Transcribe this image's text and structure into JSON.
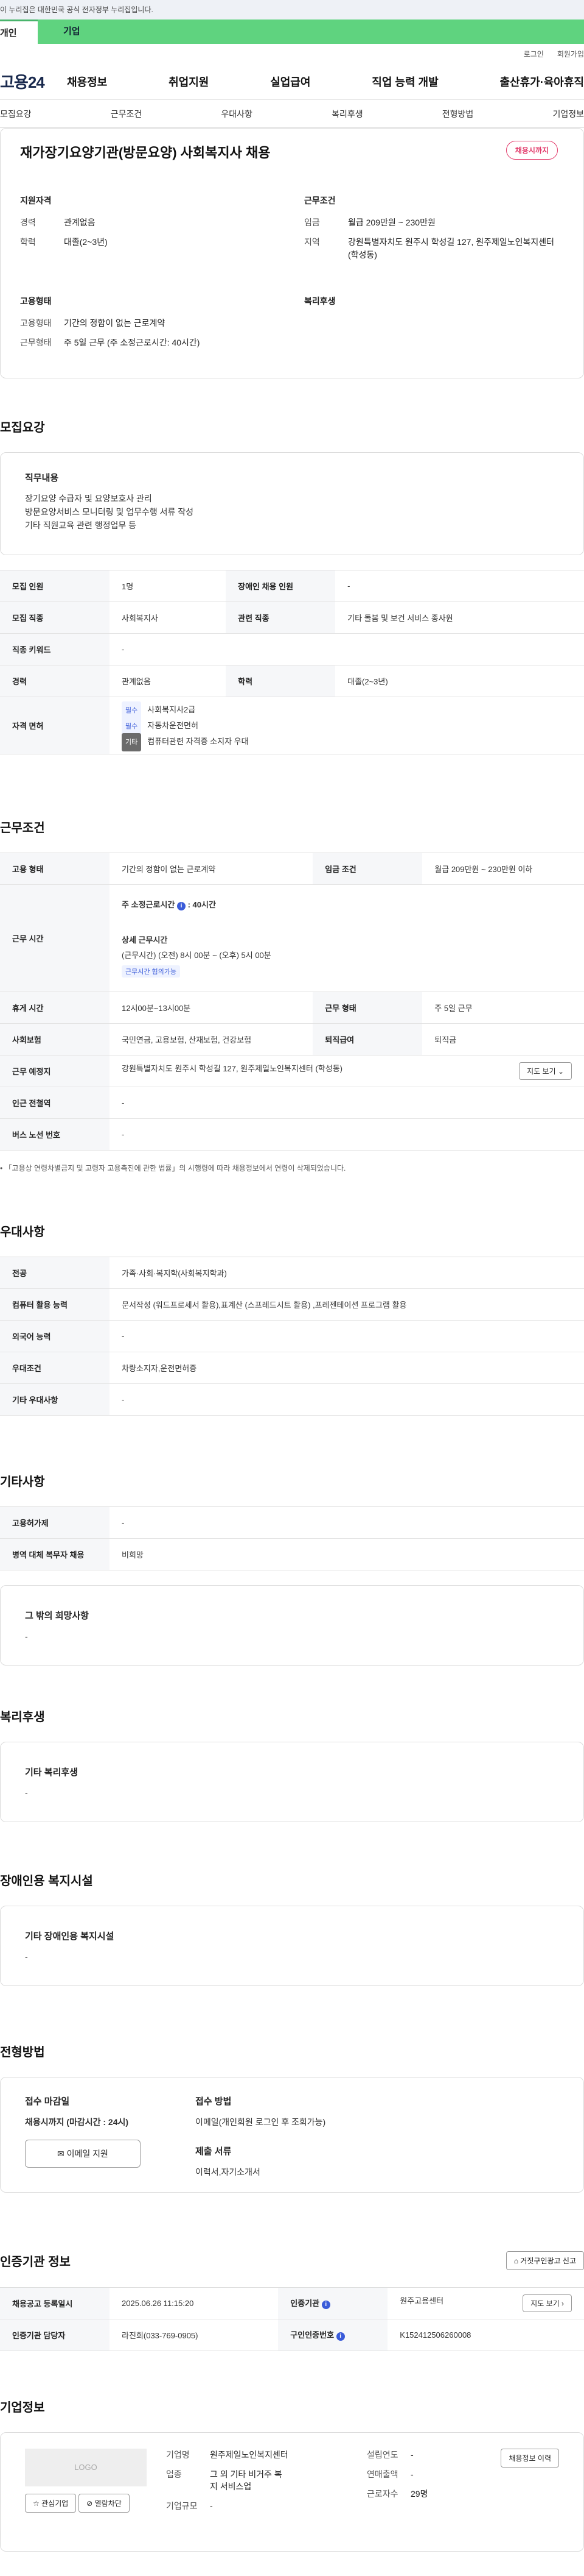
{
  "gov_banner": "이 누리집은 대한민국 공식 전자정부 누리집입니다.",
  "user_tabs": {
    "personal": "개인",
    "company": "기업"
  },
  "util": {
    "login": "로그인",
    "signup": "회원가입"
  },
  "logo": "고용24",
  "gnb": [
    "채용정보",
    "취업지원",
    "실업급여",
    "직업 능력 개발",
    "출산휴가·육아휴직"
  ],
  "lnb": [
    "모집요강",
    "근무조건",
    "우대사항",
    "복리후생",
    "전형방법",
    "기업정보"
  ],
  "job": {
    "title": "재가장기요양기관(방문요양) 사회복지사 채용",
    "deadline_badge": "채용시까지",
    "summary": {
      "qualification_title": "지원자격",
      "career_label": "경력",
      "career_value": "관계없음",
      "education_label": "학력",
      "education_value": "대졸(2~3년)",
      "conditions_title": "근무조건",
      "wage_label": "임금",
      "wage_value": "월급 209만원 ~ 230만원",
      "region_label": "지역",
      "region_value": "강원특별자치도 원주시 학성길 127, 원주제일노인복지센터 (학성동)",
      "employment_title": "고용형태",
      "employment_label": "고용형태",
      "employment_value": "기간의 정함이 없는 근로계약",
      "worktime_label": "근무형태",
      "worktime_value": "주 5일 근무 (주 소정근로시간: 40시간)",
      "welfare_title": "복리후생"
    }
  },
  "recruit": {
    "section_title": "모집요강",
    "duty_title": "직무내용",
    "duty_lines": [
      "장기요양 수급자 및 요양보호사 관리",
      "방문요양서비스 모니터링 및 업무수행 서류 작성",
      "기타 직원교육 관련 행정업무 등"
    ],
    "rows": {
      "count_k": "모집 인원",
      "count_v": "1명",
      "disabled_k": "장애인 채용 인원",
      "disabled_v": "-",
      "job_k": "모집 직종",
      "job_v": "사회복지사",
      "related_k": "관련 직종",
      "related_v": "기타 돌봄 및 보건 서비스 종사원",
      "keyword_k": "직종 키워드",
      "keyword_v": "-",
      "career_k": "경력",
      "career_v": "관계없음",
      "edu_k": "학력",
      "edu_v": "대졸(2~3년)",
      "license_k": "자격 면허"
    },
    "licenses": [
      {
        "tag": "필수",
        "name": "사회복지사2급"
      },
      {
        "tag": "필수",
        "name": "자동차운전면허"
      },
      {
        "tag": "기타",
        "name": "컴퓨터관련 자격증 소지자 우대"
      }
    ]
  },
  "conditions": {
    "section_title": "근무조건",
    "emp_k": "고용 형태",
    "emp_v": "기간의 정함이 없는 근로계약",
    "wage_k": "임금 조건",
    "wage_v": "월급 209만원 ~ 230만원 이하",
    "time_k": "근무 시간",
    "time_main": "주 소정근로시간",
    "time_hours": "40시간",
    "time_detail_title": "상세 근무시간",
    "time_detail": "(근무시간) (오전) 8시 00분 ~ (오후) 5시 00분",
    "time_consult": "근무시간 협의가능",
    "break_k": "휴게 시간",
    "break_v": "12시00분~13시00분",
    "type_k": "근무 형태",
    "type_v": "주 5일 근무",
    "ins_k": "사회보험",
    "ins_v": "국민연금, 고용보험, 산재보험, 건강보험",
    "sev_k": "퇴직급여",
    "sev_v": "퇴직금",
    "addr_k": "근무 예정지",
    "addr_v": "강원특별자치도 원주시 학성길 127, 원주제일노인복지센터 (학성동)",
    "map_btn": "지도 보기",
    "station_k": "인근 전철역",
    "station_v": "-",
    "bus_k": "버스 노선 번호",
    "bus_v": "-",
    "note": "「고용상 연령차별금지 및 고령자 고용촉진에 관한 법률」의 시행령에 따라 채용정보에서 연령이 삭제되었습니다."
  },
  "preferences": {
    "section_title": "우대사항",
    "major_k": "전공",
    "major_v": "가족·사회·복지학(사회복지학과)",
    "computer_k": "컴퓨터 활용 능력",
    "computer_v": "문서작성 (워드프로세서 활용),표계산 (스프레드시트 활용) ,프레젠테이션 프로그램 활용",
    "lang_k": "외국어 능력",
    "lang_v": "-",
    "cond_k": "우대조건",
    "cond_v": "차량소지자,운전면허증",
    "etc_k": "기타 우대사항",
    "etc_v": "-"
  },
  "others": {
    "section_title": "기타사항",
    "device_k": "고용허가제",
    "device_v": "-",
    "military_k": "병역 대체 복무자 채용",
    "military_v": "비희망",
    "wish_title": "그 밖의 희망사항",
    "wish_v": "-"
  },
  "welfare": {
    "section_title": "복리후생",
    "box_title": "기타 복리후생",
    "box_v": "-"
  },
  "disabled": {
    "section_title": "장애인용 복지시설",
    "box_title": "기타 장애인용 복지시설",
    "box_v": "-"
  },
  "selection": {
    "section_title": "전형방법",
    "deadline_title": "접수 마감일",
    "deadline_v": "채용시까지 (마감시간 : 24시)",
    "method_title": "접수 방법",
    "method_v": "이메일(개인회원 로그인 후 조회가능)",
    "docs_title": "제출 서류",
    "docs_v": "이력서,자기소개서",
    "email_btn": "이메일 지원"
  },
  "certification": {
    "section_title": "인증기관 정보",
    "report_btn": "거짓구인광고 신고",
    "reg_k": "채용공고 등록일시",
    "reg_v": "2025.06.26 11:15:20",
    "org_k": "인증기관",
    "org_v": "원주고용센터",
    "map_btn": "지도 보기",
    "manager_k": "인증기관 담당자",
    "manager_v": "라진희(033-769-0905)",
    "id_k": "구인인증번호",
    "id_v": "K152412506260008"
  },
  "company": {
    "section_title": "기업정보",
    "logo_placeholder": "LOGO",
    "interest_btn": "관심기업",
    "block_btn": "열람차단",
    "name_k": "기업명",
    "name_v": "원주제일노인복지센터",
    "industry_k": "업종",
    "industry_v": "그 외 기타 비거주 복지 서비스업",
    "size_k": "기업규모",
    "size_v": "-",
    "year_k": "설립연도",
    "year_v": "-",
    "sales_k": "연매출액",
    "sales_v": "-",
    "emp_k": "근로자수",
    "emp_v": "29명",
    "more_btn": "채용정보 이력"
  }
}
